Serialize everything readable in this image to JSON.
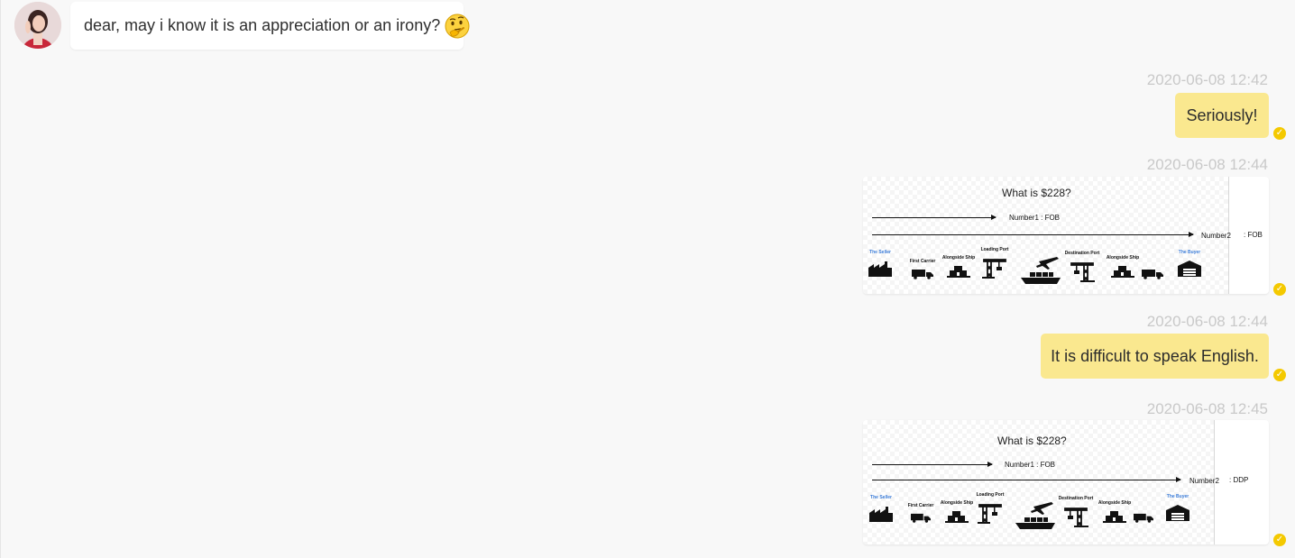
{
  "incoming": {
    "text": "dear, may i know it is an appreciation or an irony?",
    "emoji": "thinking-face-icon"
  },
  "messages": [
    {
      "timestamp": "2020-06-08 12:42",
      "type": "text",
      "text": "Seriously!"
    },
    {
      "timestamp": "2020-06-08 12:44",
      "type": "image",
      "figure": {
        "title": "What is $228?",
        "label1": "Number1 : FOB",
        "label2": "Number2",
        "label2_value": ": FOB",
        "stages": [
          "The Seller",
          "First Carrier",
          "Alongside Ship",
          "Loading Port",
          "",
          "Destination Port",
          "Alongside Ship",
          "",
          "The Buyer"
        ]
      }
    },
    {
      "timestamp": "2020-06-08 12:44",
      "type": "text",
      "text": "It is difficult to speak English."
    },
    {
      "timestamp": "2020-06-08 12:45",
      "type": "image",
      "figure": {
        "title": "What is $228?",
        "label1": "Number1 : FOB",
        "label2": "Number2",
        "label2_value": ": DDP",
        "stages": [
          "The Seller",
          "First Carrier",
          "Alongside Ship",
          "Loading Port",
          "",
          "Destination Port",
          "Alongside Ship",
          "",
          "The Buyer"
        ]
      }
    }
  ],
  "colors": {
    "bubble_out": "#fae88f",
    "check": "#f4c900",
    "timestamp": "#c9c9c9",
    "seller_buyer_label": "#3c7dd9"
  }
}
